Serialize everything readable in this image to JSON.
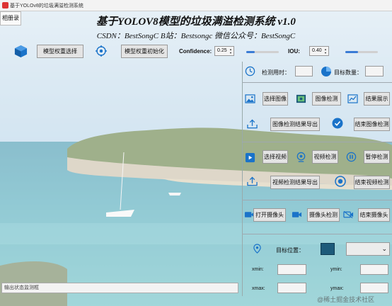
{
  "window": {
    "title": "基于YOLOv8的垃圾满溢检测系统"
  },
  "menu": {
    "label": "相册录"
  },
  "header": {
    "title": "基于YOLOV8模型的垃圾满溢检测系统 v1.0",
    "subtitle": "CSDN：BestSongC   B站：Bestsongc   微信公众号：BestSongC"
  },
  "toolbar": {
    "select_weights": "模型权重选择",
    "init_weights": "模型权重初始化",
    "confidence_label": "Confidence:",
    "confidence_value": "0.25",
    "confidence_level": 0.25,
    "iou_label": "IOU:",
    "iou_value": "0.40",
    "iou_level": 0.4
  },
  "panel": {
    "time_label": "检测用时：",
    "time_value": "",
    "count_label": "目标数量：",
    "count_value": "",
    "select_image": "选择图像",
    "detect_image": "图像检测",
    "show_result": "结果展示",
    "export_image": "图像检测结果导出",
    "end_image": "结束图像检测",
    "select_video": "选择视频",
    "detect_video": "视频检测",
    "pause_detect": "暂停检测",
    "export_video": "视频检测结果导出",
    "end_video": "结束视频检测",
    "open_camera": "打开摄像头",
    "detect_camera": "摄像头检测",
    "end_camera": "结束摄像头",
    "target_pos_label": "目标位置：",
    "target_select": "",
    "xmin_label": "xmin:",
    "xmin_value": "",
    "ymin_label": "ymin:",
    "ymin_value": "",
    "xmax_label": "xmax:",
    "xmax_value": "",
    "ymax_label": "ymax:",
    "ymax_value": ""
  },
  "status": {
    "placeholder": "输出状态监测框"
  },
  "watermark": "@稀土掘金技术社区",
  "colors": {
    "accent": "#3a7bd5",
    "icon_blue": "#1a73c9",
    "sea": "#4aa7b8"
  }
}
